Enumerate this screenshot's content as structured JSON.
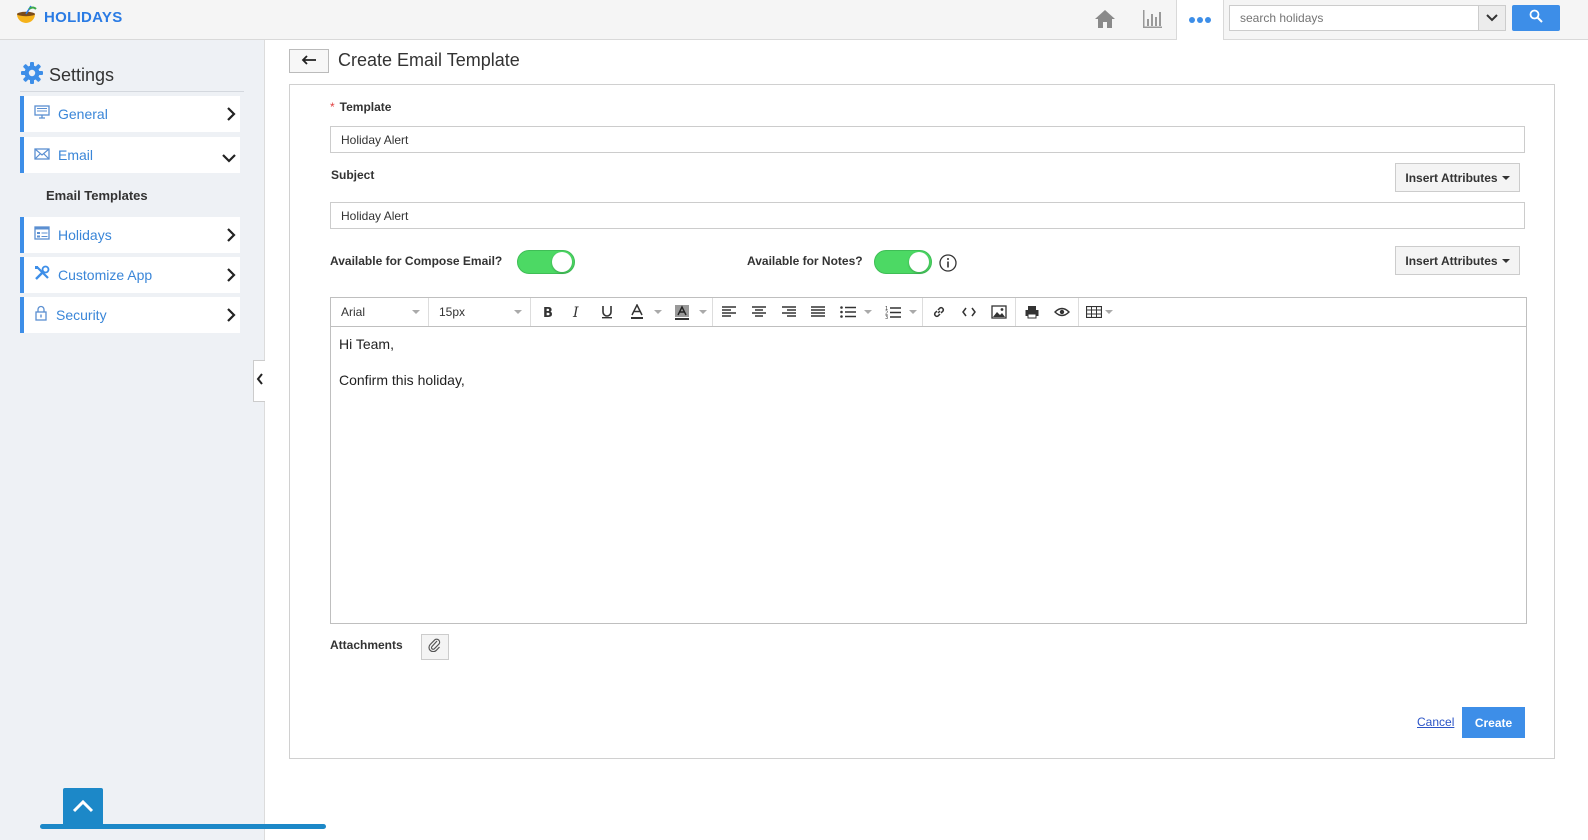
{
  "app": {
    "name": "HOLIDAYS",
    "logo_icon": "coconut-drink-icon",
    "accent_color": "#3d8ee8"
  },
  "topbar": {
    "icons": [
      "home-icon",
      "bar-chart-icon",
      "more-dots-icon"
    ],
    "search": {
      "placeholder": "search holidays",
      "value": ""
    }
  },
  "sidebar": {
    "title": "Settings",
    "items": [
      {
        "label": "General",
        "icon": "monitor-icon",
        "expanded": false
      },
      {
        "label": "Email",
        "icon": "envelope-icon",
        "expanded": true
      },
      {
        "label": "Holidays",
        "icon": "calendar-list-icon",
        "expanded": false
      },
      {
        "label": "Customize App",
        "icon": "tools-icon",
        "expanded": false
      },
      {
        "label": "Security",
        "icon": "lock-icon",
        "expanded": false
      }
    ],
    "sub_items": {
      "email": [
        "Email Templates"
      ]
    }
  },
  "main": {
    "title": "Create Email Template",
    "form": {
      "template_label": "Template",
      "template_required_mark": "*",
      "template_value": "Holiday Alert",
      "subject_label": "Subject",
      "subject_value": "Holiday Alert",
      "insert_attributes_label": "Insert Attributes",
      "compose_label": "Available for Compose Email?",
      "compose_enabled": true,
      "notes_label": "Available for Notes?",
      "notes_enabled": true,
      "toggle_on_color": "#4cd964"
    },
    "editor": {
      "font_family": "Arial",
      "font_size": "15px",
      "lines": [
        "Hi Team,",
        "Confirm this holiday,"
      ]
    },
    "attachments_label": "Attachments",
    "cancel_label": "Cancel",
    "create_label": "Create"
  }
}
